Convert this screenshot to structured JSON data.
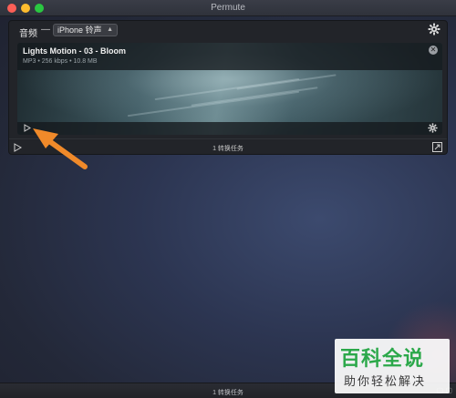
{
  "window": {
    "title": "Permute"
  },
  "preset": {
    "label": "音频",
    "separator": "—",
    "selected": "iPhone 铃声"
  },
  "item": {
    "title": "Lights Motion - 03 - Bloom",
    "meta": "MP3 • 256 kbps • 10.8 MB"
  },
  "queue": {
    "count_label": "1 转换任务"
  },
  "status_bar": {
    "count_label": "1 转换任务"
  },
  "watermark": {
    "main": "百科全说",
    "sub": "助你轻松解决"
  },
  "colors": {
    "accent_arrow": "#f08a2a",
    "watermark_green": "#2ba84a",
    "close": "#fc5f57",
    "minimize": "#fdbc2e",
    "maximize": "#2ac741"
  },
  "icons": [
    "gear-icon",
    "close-icon",
    "play-icon",
    "expand-icon",
    "arrow-annotation"
  ]
}
